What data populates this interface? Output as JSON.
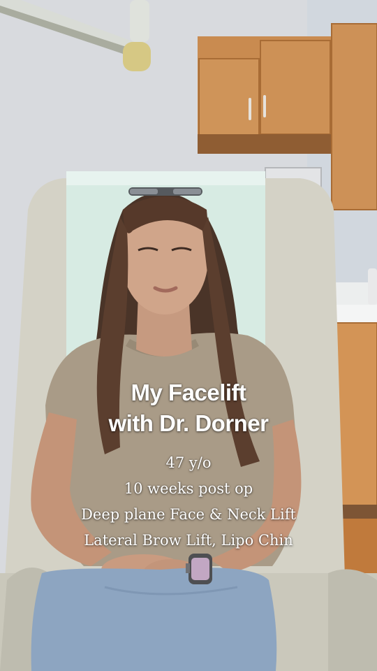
{
  "headline": {
    "line1": "My Facelift",
    "line2": "with Dr. Dorner"
  },
  "details": {
    "age": "47 y/o",
    "time_post_op": "10 weeks post op",
    "procedure_1": "Deep plane Face & Neck Lift",
    "procedure_2": "Lateral Brow Lift, Lipo Chin"
  },
  "watch_icon": "smartwatch-icon",
  "colors": {
    "caption_text": "#ffffff",
    "wall": "#d9dbe0",
    "cabinet": "#c98a4f",
    "chair": "#d3d1c6",
    "paper": "#d8ece4",
    "shirt": "#a89a86",
    "jeans": "#8ea6c2"
  }
}
